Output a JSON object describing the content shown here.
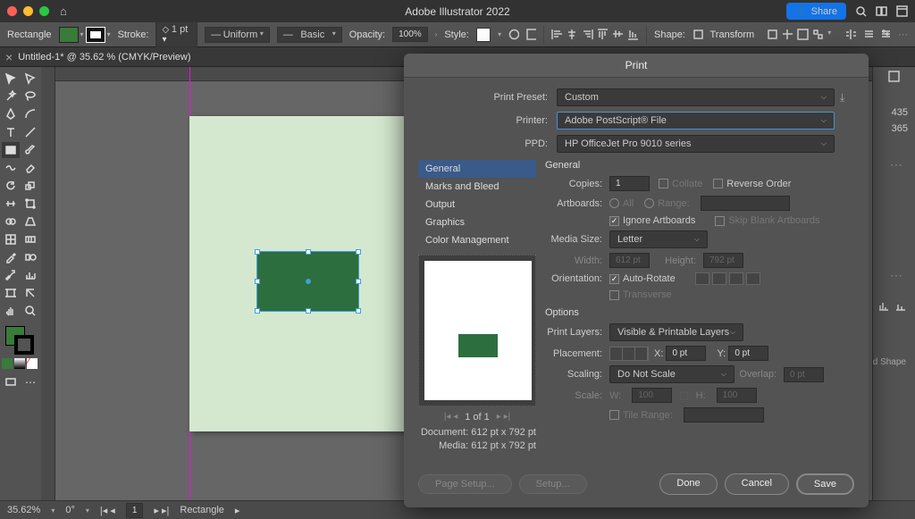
{
  "app_title": "Adobe Illustrator 2022",
  "share_label": "Share",
  "document_tab": "Untitled-1* @ 35.62 % (CMYK/Preview)",
  "optionbar": {
    "shape_label": "Rectangle",
    "stroke_label": "Stroke:",
    "stroke_weight": "1 pt",
    "stroke_profile": "Uniform",
    "brush": "Basic",
    "opacity_label": "Opacity:",
    "opacity_value": "100%",
    "style_label": "Style:",
    "shape2_label": "Shape:",
    "transform_label": "Transform"
  },
  "status": {
    "zoom": "35.62%",
    "rotate": "0°",
    "artboard_num": "1",
    "tool": "Rectangle"
  },
  "right_text": {
    "w": "435",
    "h": "365",
    "shape": "d Shape"
  },
  "dialog": {
    "title": "Print",
    "preset_label": "Print Preset:",
    "preset_value": "Custom",
    "printer_label": "Printer:",
    "printer_value": "Adobe PostScript® File",
    "ppd_label": "PPD:",
    "ppd_value": "HP OfficeJet Pro 9010 series",
    "nav": [
      "General",
      "Marks and Bleed",
      "Output",
      "Graphics",
      "Color Management"
    ],
    "section_general": "General",
    "copies_label": "Copies:",
    "copies_value": "1",
    "collate": "Collate",
    "reverse": "Reverse Order",
    "artboards_label": "Artboards:",
    "all": "All",
    "range": "Range:",
    "ignore": "Ignore Artboards",
    "skip": "Skip Blank Artboards",
    "media_label": "Media Size:",
    "media_value": "Letter",
    "width_label": "Width:",
    "width_value": "612 pt",
    "height_label": "Height:",
    "height_value": "792 pt",
    "orient_label": "Orientation:",
    "autorotate": "Auto-Rotate",
    "transverse": "Transverse",
    "options_title": "Options",
    "printlayers_label": "Print Layers:",
    "printlayers_value": "Visible & Printable Layers",
    "placement_label": "Placement:",
    "x_label": "X:",
    "x_value": "0 pt",
    "y_label": "Y:",
    "y_value": "0 pt",
    "scaling_label": "Scaling:",
    "scaling_value": "Do Not Scale",
    "overlap_label": "Overlap:",
    "overlap_value": "0 pt",
    "scale_label": "Scale:",
    "scale_w": "W:",
    "scale_wv": "100",
    "scale_h": "H:",
    "scale_hv": "100",
    "tile_label": "Tile Range:",
    "page_nav": "1 of 1",
    "doc_info": "Document: 612 pt x 792 pt",
    "media_info": "Media: 612 pt x 792 pt",
    "page_setup": "Page Setup...",
    "setup": "Setup...",
    "done": "Done",
    "cancel": "Cancel",
    "save": "Save"
  }
}
